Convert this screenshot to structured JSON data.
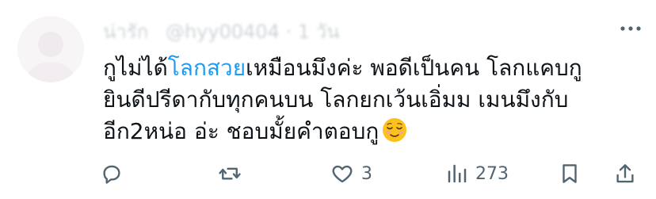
{
  "tweet": {
    "header": {
      "name": "น่ารัก",
      "handle": "@hyy00404",
      "time": "1 วัน"
    },
    "text": {
      "line1_start": "กูไม่ได้",
      "line1_link": "โลกสวย",
      "line1_end": "เหมือนมึงค่ะ พอดีเป็นคน โลกแคบกู",
      "line2": "ยินดีปรีดากับทุกคนบน โลกยกเว้นเอิ่มม เมนมึงกับ",
      "line3": "อีก2หน่อ อ่ะ ชอบมั้ยคำตอบกู"
    },
    "emoji": "relieved-face-emoji",
    "actions": {
      "reply": {
        "icon": "reply-icon",
        "count": ""
      },
      "retweet": {
        "icon": "retweet-icon",
        "count": ""
      },
      "like": {
        "icon": "heart-icon",
        "count": "3"
      },
      "views": {
        "icon": "views-chart-icon",
        "count": "273"
      },
      "bookmark": {
        "icon": "bookmark-icon"
      },
      "share": {
        "icon": "share-icon"
      }
    },
    "colors": {
      "text": "#0f1419",
      "muted": "#536471",
      "link": "#1d9bf0"
    }
  }
}
